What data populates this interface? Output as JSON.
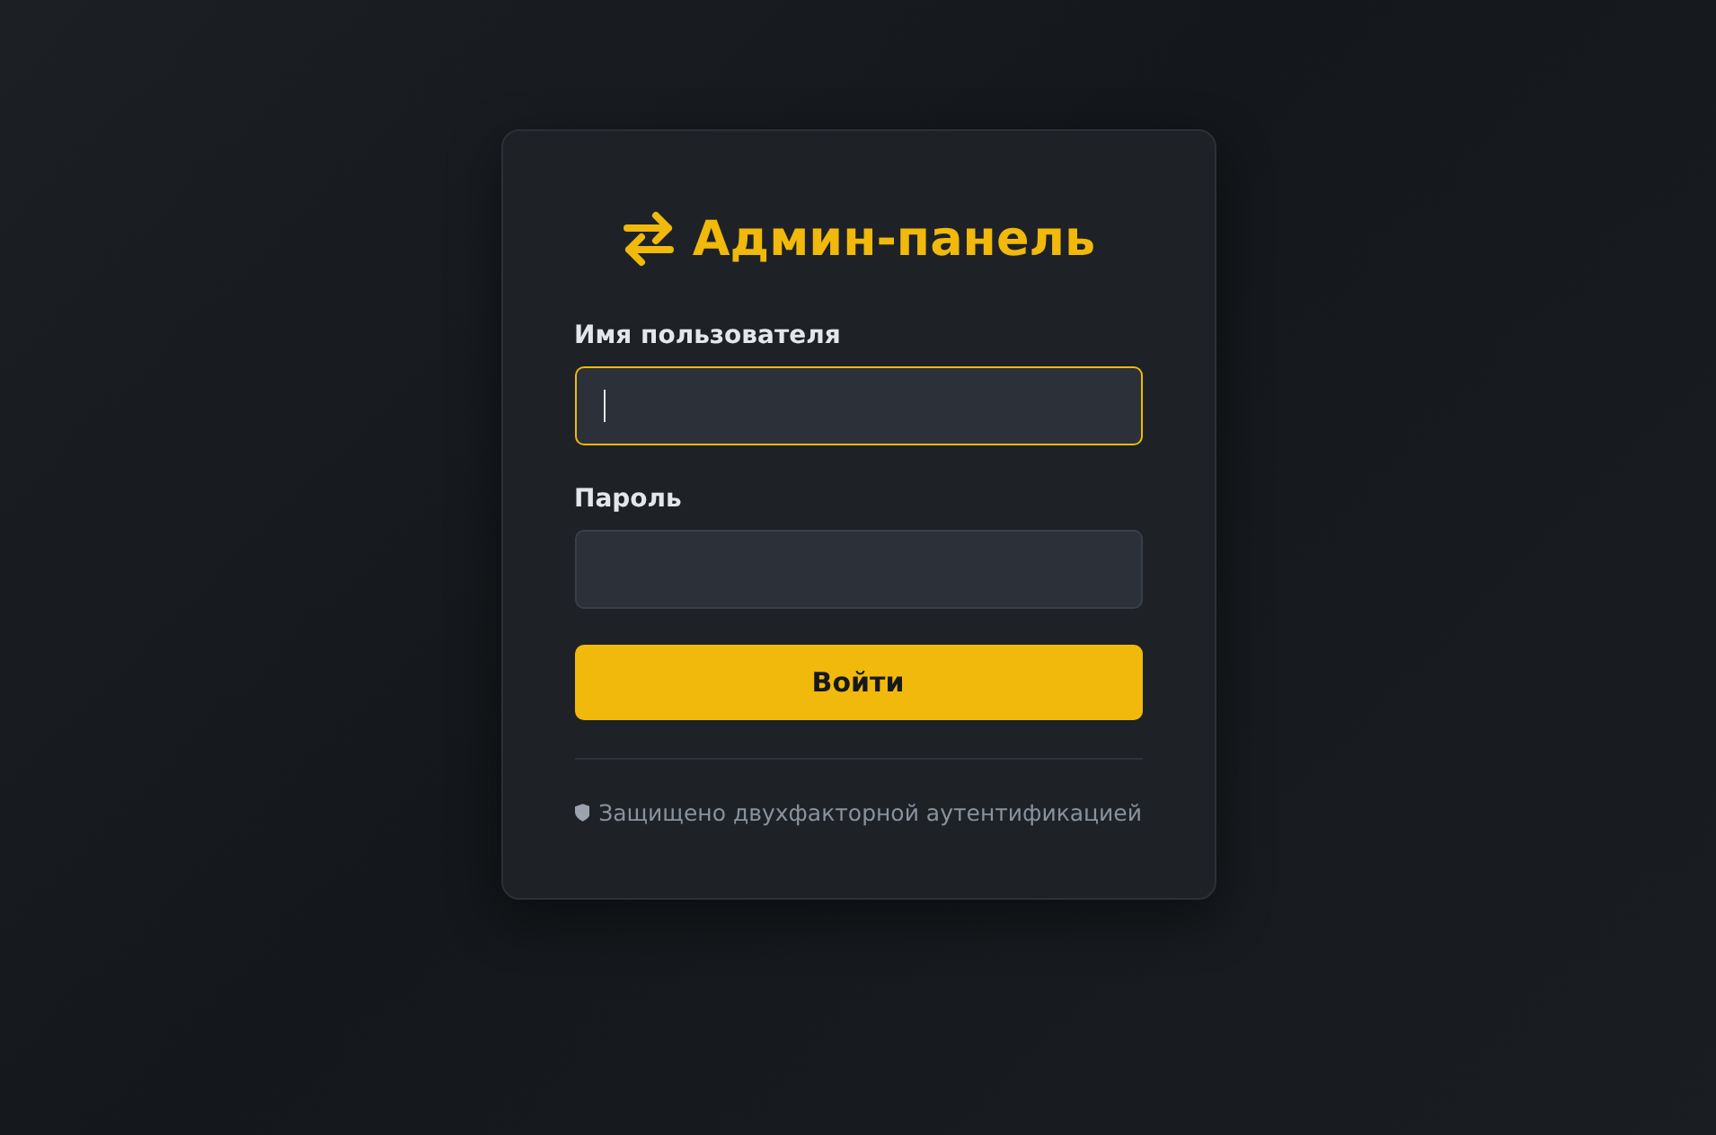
{
  "title": "Админ-панель",
  "fields": [
    {
      "label": "Имя пользователя",
      "focused": true
    },
    {
      "label": "Пароль",
      "focused": false
    }
  ],
  "button": "Войти",
  "footer": "Защищено двухфакторной аутентификацией"
}
